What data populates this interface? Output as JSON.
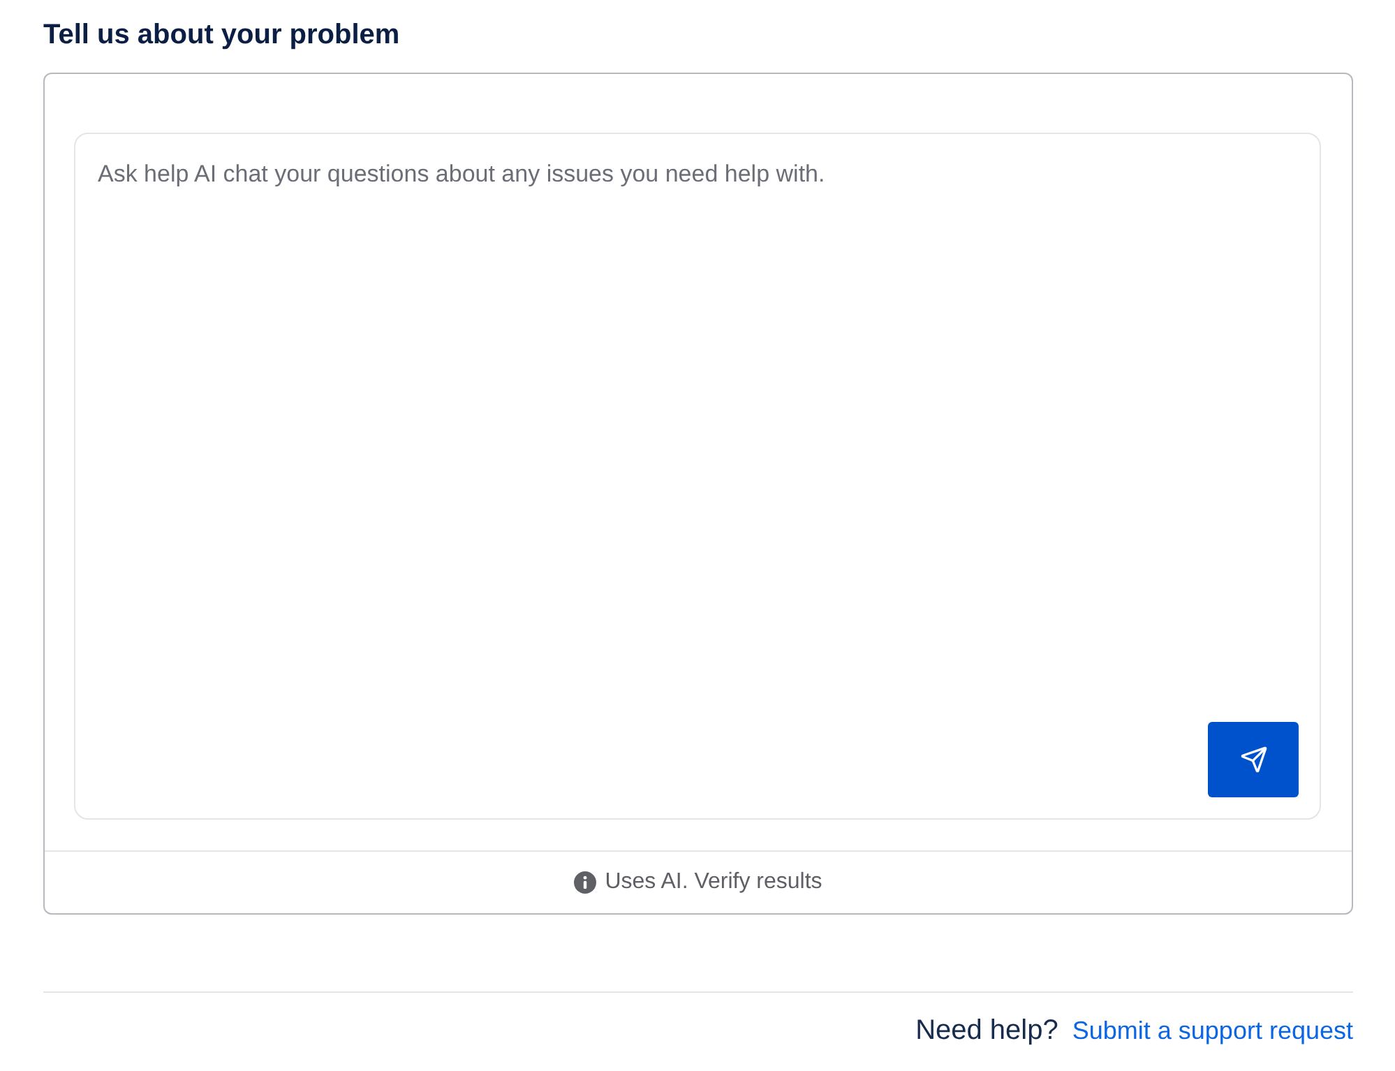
{
  "heading": "Tell us about your problem",
  "chat": {
    "placeholder": "Ask help AI chat your questions about any issues you need help with.",
    "disclaimer": "Uses AI. Verify results"
  },
  "footer": {
    "prompt": "Need help?",
    "link": "Submit a support request"
  }
}
